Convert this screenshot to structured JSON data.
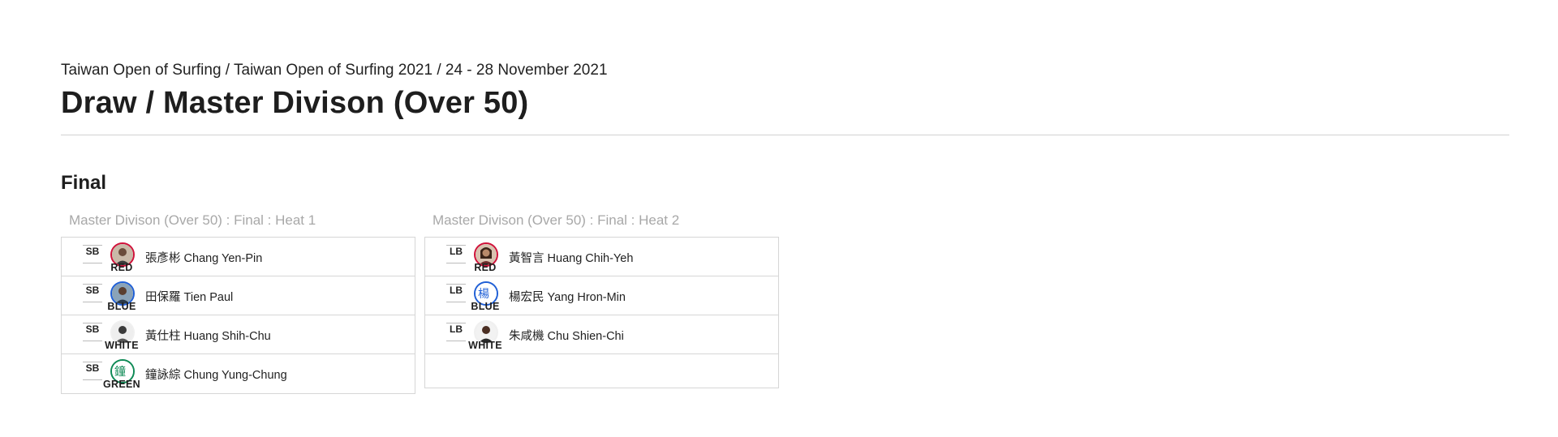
{
  "header": {
    "breadcrumb": "Taiwan Open of Surfing / Taiwan Open of Surfing 2021 / 24 - 28 November 2021",
    "title": "Draw / Master Divison (Over 50)"
  },
  "section": {
    "title": "Final"
  },
  "heats": [
    {
      "title": "Master Divison (Over 50) : Final : Heat 1",
      "rows": [
        {
          "board": "SB",
          "jersey": "RED",
          "jersey_color": "#d0113a",
          "name": "張彥彬 Chang Yen-Pin",
          "avatar": "photo"
        },
        {
          "board": "SB",
          "jersey": "BLUE",
          "jersey_color": "#1f5fd6",
          "name": "田保羅 Tien Paul",
          "avatar": "photo"
        },
        {
          "board": "SB",
          "jersey": "WHITE",
          "jersey_color": "#ffffff",
          "name": "黃仕柱 Huang Shih-Chu",
          "avatar": "photo"
        },
        {
          "board": "SB",
          "jersey": "GREEN",
          "jersey_color": "#0e8a55",
          "name": "鐘詠綜 Chung Yung-Chung",
          "avatar": "鐘",
          "avatar_initial": "鐘"
        }
      ]
    },
    {
      "title": "Master Divison (Over 50) : Final : Heat 2",
      "rows": [
        {
          "board": "LB",
          "jersey": "RED",
          "jersey_color": "#d0113a",
          "name": "黃智言 Huang Chih-Yeh",
          "avatar": "photo"
        },
        {
          "board": "LB",
          "jersey": "BLUE",
          "jersey_color": "#1f5fd6",
          "name": "楊宏民 Yang Hron-Min",
          "avatar": "楊",
          "avatar_initial": "楊"
        },
        {
          "board": "LB",
          "jersey": "WHITE",
          "jersey_color": "#ffffff",
          "name": "朱咸機 Chu Shien-Chi",
          "avatar": "photo"
        }
      ]
    }
  ]
}
